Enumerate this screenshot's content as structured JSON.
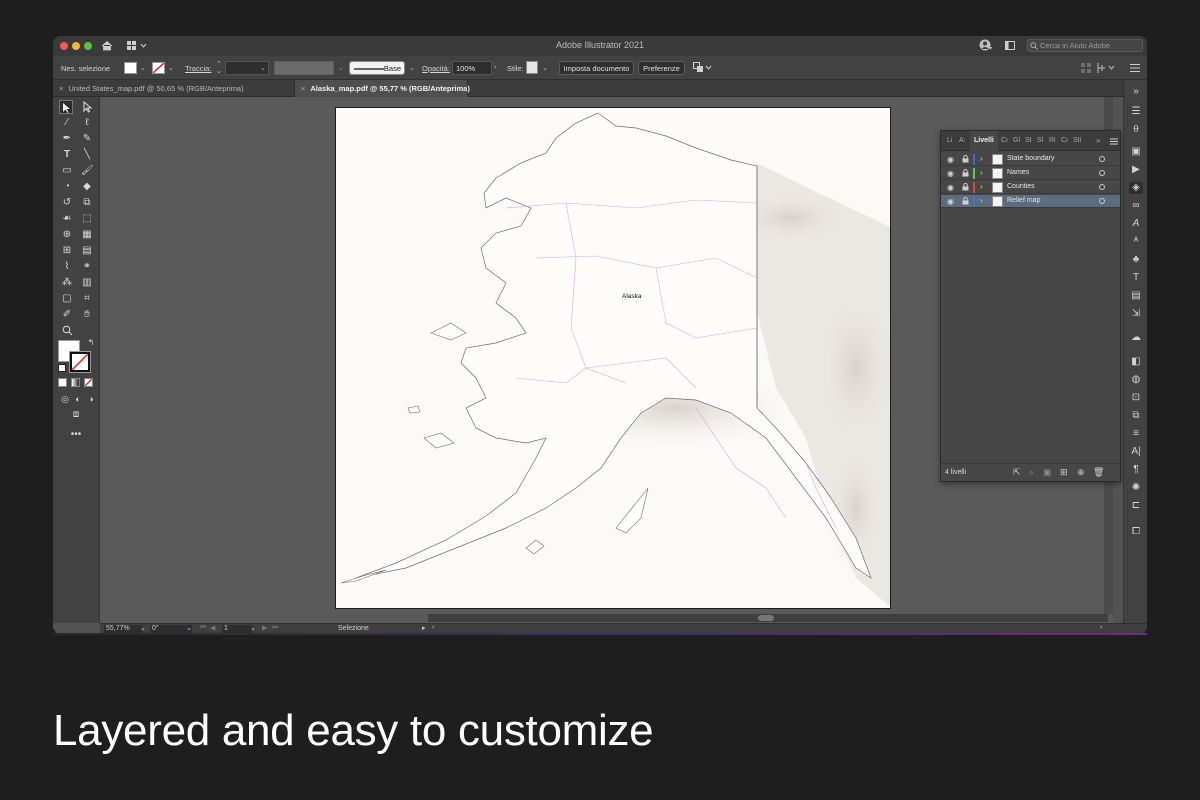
{
  "window": {
    "title": "Adobe Illustrator 2021"
  },
  "help_search": {
    "placeholder": "Cerca in Aiuto Adobe"
  },
  "control_bar": {
    "selection_label": "Nes. selezione",
    "stroke_label": "Traccia:",
    "brush_label": "Base",
    "opacity_label": "Opacità:",
    "opacity_value": "100%",
    "style_label": "Stile:",
    "document_setup_button": "Imposta documento",
    "preferences_button": "Preferenze"
  },
  "tabs": [
    {
      "label": "United States_map.pdf @ 50,65 % (RGB/Anteprima)",
      "active": false
    },
    {
      "label": "Alaska_map.pdf @ 55,77 % (RGB/Anteprima)",
      "active": true
    }
  ],
  "artboard": {
    "map_label": "Alaska"
  },
  "layers_panel": {
    "tabs": [
      "Li",
      "A:",
      "Livelli",
      "Cı",
      "Gl",
      "St",
      "Sl",
      "Ri",
      "Cı",
      "Sti"
    ],
    "active_tab": "Livelli",
    "layers": [
      {
        "name": "State boundary",
        "color": "#4b5fd6",
        "selected": false
      },
      {
        "name": "Names",
        "color": "#4fd64b",
        "selected": false
      },
      {
        "name": "Counties",
        "color": "#e04848",
        "selected": false
      },
      {
        "name": "Relief map",
        "color": "#4b6fd6",
        "selected": true
      }
    ],
    "count_label": "4 livelli"
  },
  "status_bar": {
    "zoom": "55,77%",
    "rotation": "0°",
    "artboard_number": "1",
    "mode": "Selezione"
  },
  "caption": "Layered and easy to customize"
}
